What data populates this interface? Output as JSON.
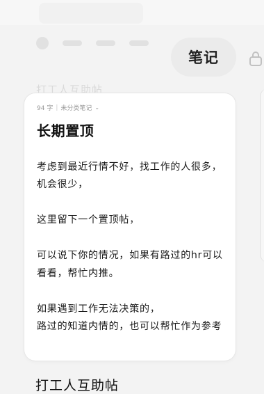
{
  "header": {
    "note_label": "笔记"
  },
  "note": {
    "meta": {
      "word_count": "94 字",
      "category": "未分类笔记"
    },
    "title": "长期置顶",
    "body": "考虑到最近行情不好，找工作的人很多，机会很少，\n\n这里留下一个置顶帖，\n\n可以说下你的情况，如果有路过的hr可以看看，帮忙内推。\n\n如果遇到工作无法决策的，\n路过的知道内情的，也可以帮忙作为参考"
  },
  "section": {
    "title": "打工人互助帖"
  },
  "icons": {
    "chevron": "chevron-down-icon",
    "lock": "lock-icon"
  },
  "colors": {
    "background": "#f3f3f3",
    "card": "#ffffff",
    "button": "#ebebeb",
    "text": "#111111",
    "muted": "#999999"
  }
}
